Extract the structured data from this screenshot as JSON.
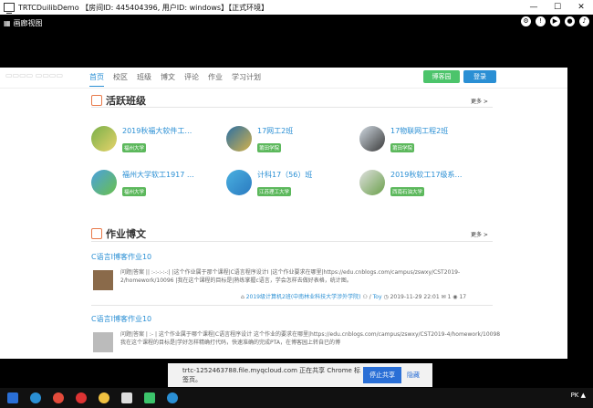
{
  "window": {
    "title": "TRTCDuilibDemo 【房间ID: 445404396, 用户ID: windows】【正式环境】",
    "minimize": "—",
    "maximize": "☐",
    "close": "✕"
  },
  "share_bar": {
    "label": "画廊视图"
  },
  "site": {
    "nav": [
      "首页",
      "校区",
      "班级",
      "博文",
      "评论",
      "作业",
      "学习计划"
    ],
    "blog_button": "博客园",
    "login_button": "登录"
  },
  "active_classes": {
    "title": "活跃班级",
    "more": "更多 >",
    "items": [
      {
        "name": "2019秋福大软件工程...",
        "school": "福州大学"
      },
      {
        "name": "17网工2班",
        "school": "莆田学院"
      },
      {
        "name": "17物联网工程2班",
        "school": "莆田学院"
      },
      {
        "name": "福州大学软工1917 | K 班",
        "school": "福州大学"
      },
      {
        "name": "计科17（56）班",
        "school": "江苏理工大学"
      },
      {
        "name": "2019秋软工17级系统...",
        "school": "西南石油大学"
      }
    ]
  },
  "homework": {
    "title": "作业博文",
    "more": "更多 >",
    "posts": [
      {
        "title": "C语言I博客作业10",
        "text": "问题|答案 || :-:-:-:-:| |这个作业属于那个课程|C语言程序设计I |这个作业要求在哪里|https://edu.cnblogs.com/campus/zswxy/CST2019-2/homework/10096 |我在这个课程的目标是|熟练掌握c语言，学会怎样去做好表格，统计图。",
        "class_link": "2019级计算机2班(中南林业科技大学涉外学院)",
        "author": "Toy",
        "date": "2019-11-29 22:01",
        "comments": "1",
        "views": "17"
      },
      {
        "title": "C语言I博客作业10",
        "text": "问题|答案 | :- | 这个作业属于哪个课程|C语言程序设计 这个作业的要求在哪里|https://edu.cnblogs.com/campus/zswxy/CST2019-4/homework/10098 我在这个课程的目标是|学好怎样精确打代码，快速准确的完成PTA，在博客园上转自已的博"
      }
    ]
  },
  "share_notice": {
    "text": "trtc-1252463788.file.myqcloud.com 正在共享 Chrome 标签页。",
    "stop": "停止共享",
    "hide": "隐藏"
  }
}
